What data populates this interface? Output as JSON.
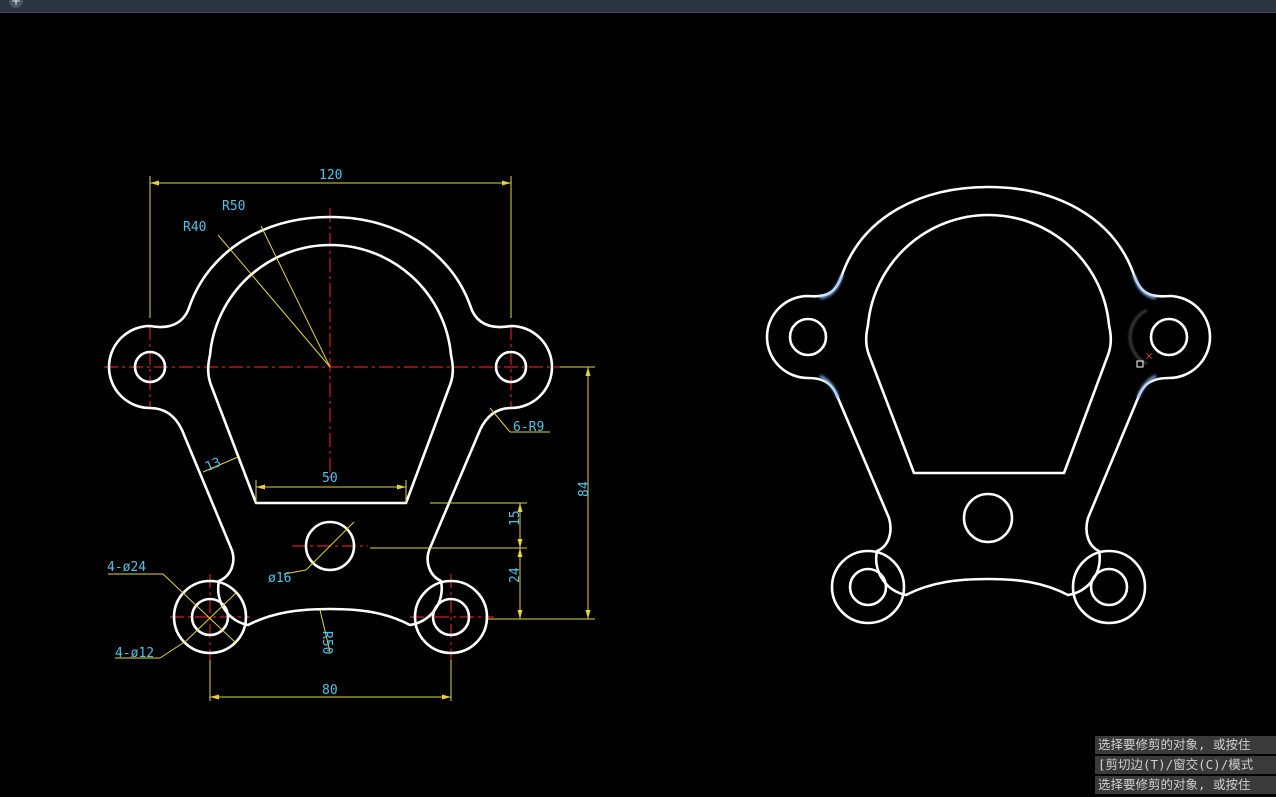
{
  "toolbar": {
    "new_tab_symbol": "+"
  },
  "drawing": {
    "dimensions": {
      "overall_width": "120",
      "outer_radius": "R50",
      "inner_radius": "R40",
      "wall_thickness": "13",
      "bottom_width": "50",
      "small_fillets": "6-R9",
      "total_height": "84",
      "hole_offset": "15",
      "lower_offset": "24",
      "small_hole_dia": "ø16",
      "boss_outer_dia": "4-ø24",
      "boss_inner_dia": "4-ø12",
      "bottom_arc_radius": "R50",
      "boss_spacing": "80"
    },
    "colors": {
      "outline": "#ffffff",
      "dimension": "#e5d33a",
      "dimension_text": "#4fc3e8",
      "centerline": "#d11f1f",
      "highlight": "#8ab4f8",
      "background": "#000000"
    }
  },
  "command_line": {
    "lines": [
      "选择要修剪的对象, 或按住",
      " [剪切边(T)/窗交(C)/模式",
      "选择要修剪的对象, 或按住"
    ]
  }
}
